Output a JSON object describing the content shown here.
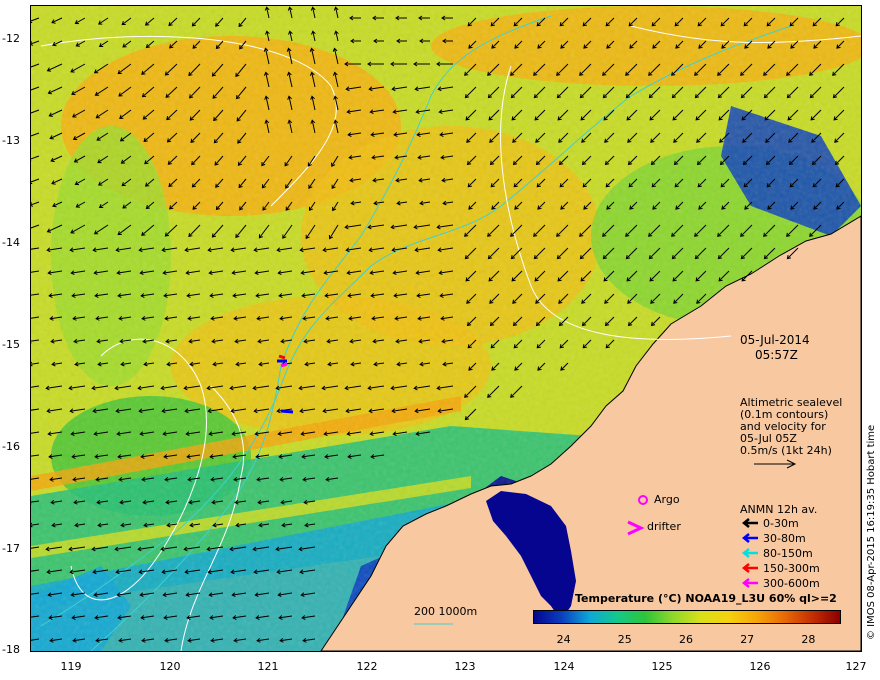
{
  "map": {
    "date": "05-Jul-2014",
    "time": "05:57Z",
    "y_ticks": [
      "-12",
      "-13",
      "-14",
      "-15",
      "-16",
      "-17",
      "-18"
    ],
    "x_ticks": [
      "119",
      "120",
      "121",
      "122",
      "123",
      "124",
      "125",
      "126",
      "127"
    ],
    "lat_range": [
      -18,
      -11.85
    ],
    "lon_range": [
      118.6,
      127
    ]
  },
  "altimetry": {
    "line1": "Altimetric sealevel",
    "line2": "(0.1m contours)",
    "line3": "and velocity for",
    "line4": "05-Jul 05Z",
    "line5": "0.5m/s (1kt 24h)"
  },
  "markers": {
    "argo": "Argo",
    "drifter": "drifter"
  },
  "anmn": {
    "title": "ANMN 12h av.",
    "items": [
      {
        "label": "0-30m",
        "color": "#000000"
      },
      {
        "label": "30-80m",
        "color": "#0000ff"
      },
      {
        "label": "80-150m",
        "color": "#00e0e0"
      },
      {
        "label": "150-300m",
        "color": "#ff0000"
      },
      {
        "label": "300-600m",
        "color": "#ff00ff"
      }
    ]
  },
  "isobath": {
    "label": "200  1000m"
  },
  "colorbar": {
    "title": "Temperature (°C) NOAA19_L3U 60% ql>=2",
    "ticks": [
      "24",
      "25",
      "26",
      "27",
      "28"
    ],
    "range": [
      23.5,
      28.5
    ],
    "colors": [
      "#05058f",
      "#0a3fbf",
      "#0fa7d6",
      "#14c98a",
      "#2fc43a",
      "#8fd82a",
      "#d8e01a",
      "#f6d10f",
      "#f6a509",
      "#e86a06",
      "#c42f02",
      "#8a0000"
    ]
  },
  "colors": {
    "land": "#f8c8a0",
    "isobath_200": "#40d0d0",
    "isobath_1000": "#40d0d0",
    "sealevel_contour": "#ffffff"
  },
  "credit": "© IMOS 08-Apr-2015 16:19:35 Hobart time"
}
